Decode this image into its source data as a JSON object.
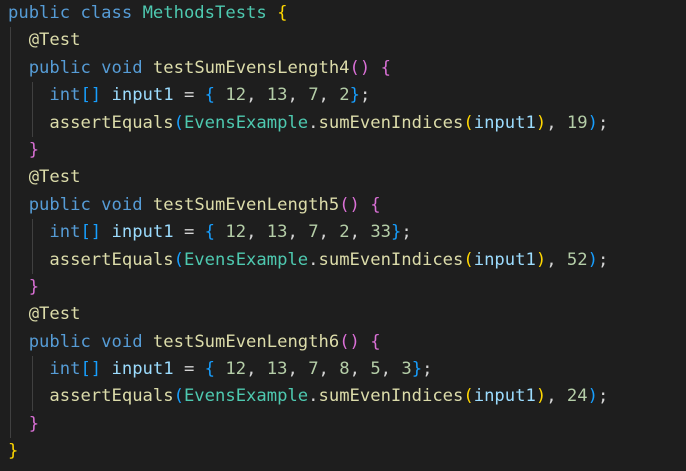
{
  "editor": {
    "lines": [
      [
        {
          "t": "public",
          "c": "kw"
        },
        {
          "t": " ",
          "c": "plain"
        },
        {
          "t": "class",
          "c": "kw"
        },
        {
          "t": " ",
          "c": "plain"
        },
        {
          "t": "MethodsTests",
          "c": "cls"
        },
        {
          "t": " ",
          "c": "plain"
        },
        {
          "t": "{",
          "c": "b1"
        }
      ],
      [
        {
          "t": "  ",
          "c": "plain"
        },
        {
          "t": "@Test",
          "c": "ann"
        }
      ],
      [
        {
          "t": "  ",
          "c": "plain"
        },
        {
          "t": "public",
          "c": "kw"
        },
        {
          "t": " ",
          "c": "plain"
        },
        {
          "t": "void",
          "c": "kw"
        },
        {
          "t": " ",
          "c": "plain"
        },
        {
          "t": "testSumEvensLength4",
          "c": "fn"
        },
        {
          "t": "()",
          "c": "b2"
        },
        {
          "t": " ",
          "c": "plain"
        },
        {
          "t": "{",
          "c": "b2"
        }
      ],
      [
        {
          "t": "    ",
          "c": "plain"
        },
        {
          "t": "int",
          "c": "kw"
        },
        {
          "t": "[]",
          "c": "b3"
        },
        {
          "t": " ",
          "c": "plain"
        },
        {
          "t": "input1",
          "c": "var"
        },
        {
          "t": " = ",
          "c": "plain"
        },
        {
          "t": "{",
          "c": "b3"
        },
        {
          "t": " ",
          "c": "plain"
        },
        {
          "t": "12",
          "c": "num"
        },
        {
          "t": ", ",
          "c": "plain"
        },
        {
          "t": "13",
          "c": "num"
        },
        {
          "t": ", ",
          "c": "plain"
        },
        {
          "t": "7",
          "c": "num"
        },
        {
          "t": ", ",
          "c": "plain"
        },
        {
          "t": "2",
          "c": "num"
        },
        {
          "t": "}",
          "c": "b3"
        },
        {
          "t": ";",
          "c": "plain"
        }
      ],
      [
        {
          "t": "    ",
          "c": "plain"
        },
        {
          "t": "assertEquals",
          "c": "fn"
        },
        {
          "t": "(",
          "c": "b3"
        },
        {
          "t": "EvensExample",
          "c": "cls"
        },
        {
          "t": ".",
          "c": "plain"
        },
        {
          "t": "sumEvenIndices",
          "c": "fn"
        },
        {
          "t": "(",
          "c": "b1"
        },
        {
          "t": "input1",
          "c": "var"
        },
        {
          "t": ")",
          "c": "b1"
        },
        {
          "t": ", ",
          "c": "plain"
        },
        {
          "t": "19",
          "c": "num"
        },
        {
          "t": ")",
          "c": "b3"
        },
        {
          "t": ";",
          "c": "plain"
        }
      ],
      [
        {
          "t": "  ",
          "c": "plain"
        },
        {
          "t": "}",
          "c": "b2"
        }
      ],
      [
        {
          "t": "  ",
          "c": "plain"
        },
        {
          "t": "@Test",
          "c": "ann"
        }
      ],
      [
        {
          "t": "  ",
          "c": "plain"
        },
        {
          "t": "public",
          "c": "kw"
        },
        {
          "t": " ",
          "c": "plain"
        },
        {
          "t": "void",
          "c": "kw"
        },
        {
          "t": " ",
          "c": "plain"
        },
        {
          "t": "testSumEvenLength5",
          "c": "fn"
        },
        {
          "t": "()",
          "c": "b2"
        },
        {
          "t": " ",
          "c": "plain"
        },
        {
          "t": "{",
          "c": "b2"
        }
      ],
      [
        {
          "t": "    ",
          "c": "plain"
        },
        {
          "t": "int",
          "c": "kw"
        },
        {
          "t": "[]",
          "c": "b3"
        },
        {
          "t": " ",
          "c": "plain"
        },
        {
          "t": "input1",
          "c": "var"
        },
        {
          "t": " = ",
          "c": "plain"
        },
        {
          "t": "{",
          "c": "b3"
        },
        {
          "t": " ",
          "c": "plain"
        },
        {
          "t": "12",
          "c": "num"
        },
        {
          "t": ", ",
          "c": "plain"
        },
        {
          "t": "13",
          "c": "num"
        },
        {
          "t": ", ",
          "c": "plain"
        },
        {
          "t": "7",
          "c": "num"
        },
        {
          "t": ", ",
          "c": "plain"
        },
        {
          "t": "2",
          "c": "num"
        },
        {
          "t": ", ",
          "c": "plain"
        },
        {
          "t": "33",
          "c": "num"
        },
        {
          "t": "}",
          "c": "b3"
        },
        {
          "t": ";",
          "c": "plain"
        }
      ],
      [
        {
          "t": "    ",
          "c": "plain"
        },
        {
          "t": "assertEquals",
          "c": "fn"
        },
        {
          "t": "(",
          "c": "b3"
        },
        {
          "t": "EvensExample",
          "c": "cls"
        },
        {
          "t": ".",
          "c": "plain"
        },
        {
          "t": "sumEvenIndices",
          "c": "fn"
        },
        {
          "t": "(",
          "c": "b1"
        },
        {
          "t": "input1",
          "c": "var"
        },
        {
          "t": ")",
          "c": "b1"
        },
        {
          "t": ", ",
          "c": "plain"
        },
        {
          "t": "52",
          "c": "num"
        },
        {
          "t": ")",
          "c": "b3"
        },
        {
          "t": ";",
          "c": "plain"
        }
      ],
      [
        {
          "t": "  ",
          "c": "plain"
        },
        {
          "t": "}",
          "c": "b2"
        }
      ],
      [
        {
          "t": "  ",
          "c": "plain"
        },
        {
          "t": "@Test",
          "c": "ann"
        }
      ],
      [
        {
          "t": "  ",
          "c": "plain"
        },
        {
          "t": "public",
          "c": "kw"
        },
        {
          "t": " ",
          "c": "plain"
        },
        {
          "t": "void",
          "c": "kw"
        },
        {
          "t": " ",
          "c": "plain"
        },
        {
          "t": "testSumEvenLength6",
          "c": "fn"
        },
        {
          "t": "()",
          "c": "b2"
        },
        {
          "t": " ",
          "c": "plain"
        },
        {
          "t": "{",
          "c": "b2"
        }
      ],
      [
        {
          "t": "    ",
          "c": "plain"
        },
        {
          "t": "int",
          "c": "kw"
        },
        {
          "t": "[]",
          "c": "b3"
        },
        {
          "t": " ",
          "c": "plain"
        },
        {
          "t": "input1",
          "c": "var"
        },
        {
          "t": " = ",
          "c": "plain"
        },
        {
          "t": "{",
          "c": "b3"
        },
        {
          "t": " ",
          "c": "plain"
        },
        {
          "t": "12",
          "c": "num"
        },
        {
          "t": ", ",
          "c": "plain"
        },
        {
          "t": "13",
          "c": "num"
        },
        {
          "t": ", ",
          "c": "plain"
        },
        {
          "t": "7",
          "c": "num"
        },
        {
          "t": ", ",
          "c": "plain"
        },
        {
          "t": "8",
          "c": "num"
        },
        {
          "t": ", ",
          "c": "plain"
        },
        {
          "t": "5",
          "c": "num"
        },
        {
          "t": ", ",
          "c": "plain"
        },
        {
          "t": "3",
          "c": "num"
        },
        {
          "t": "}",
          "c": "b3"
        },
        {
          "t": ";",
          "c": "plain"
        }
      ],
      [
        {
          "t": "    ",
          "c": "plain"
        },
        {
          "t": "assertEquals",
          "c": "fn"
        },
        {
          "t": "(",
          "c": "b3"
        },
        {
          "t": "EvensExample",
          "c": "cls"
        },
        {
          "t": ".",
          "c": "plain"
        },
        {
          "t": "sumEvenIndices",
          "c": "fn"
        },
        {
          "t": "(",
          "c": "b1"
        },
        {
          "t": "input1",
          "c": "var"
        },
        {
          "t": ")",
          "c": "b1"
        },
        {
          "t": ", ",
          "c": "plain"
        },
        {
          "t": "24",
          "c": "num"
        },
        {
          "t": ")",
          "c": "b3"
        },
        {
          "t": ";",
          "c": "plain"
        }
      ],
      [
        {
          "t": "  ",
          "c": "plain"
        },
        {
          "t": "}",
          "c": "b2"
        }
      ],
      [
        {
          "t": "}",
          "c": "b1"
        }
      ]
    ]
  },
  "theme": {
    "background": "#1e1e1e",
    "keyword": "#569cd6",
    "class": "#4ec9b0",
    "function": "#dcdcaa",
    "variable": "#9cdcfe",
    "number": "#b5cea8",
    "bracket_level1": "#ffd700",
    "bracket_level2": "#da70d6",
    "bracket_level3": "#179fff"
  }
}
